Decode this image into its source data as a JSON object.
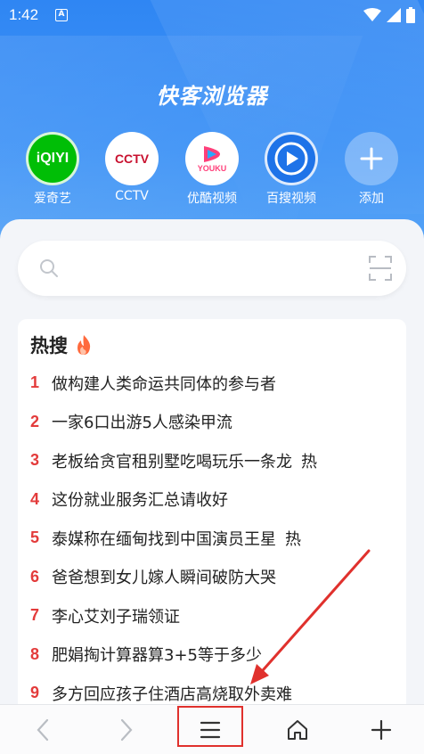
{
  "status_bar": {
    "time": "1:42",
    "notif_icon": "a-box-icon",
    "icons": [
      "wifi-icon",
      "signal-icon",
      "battery-icon"
    ]
  },
  "app": {
    "title": "快客浏览器"
  },
  "shortcuts": [
    {
      "label": "爱奇艺",
      "logo_text": "iQIYI",
      "icon": "iqiyi-logo-icon",
      "color": "#00be06"
    },
    {
      "label": "CCTV",
      "logo_text": "CCTV",
      "icon": "cctv-logo-icon",
      "color": "#ffffff"
    },
    {
      "label": "优酷视频",
      "logo_text": "YOUKU",
      "icon": "youku-logo-icon",
      "color": "#ffffff"
    },
    {
      "label": "百搜视频",
      "logo_text": "",
      "icon": "play-icon",
      "color": "#1e73e8"
    },
    {
      "label": "添加",
      "logo_text": "+",
      "icon": "plus-icon",
      "color": "rgba(255,255,255,0.35)"
    }
  ],
  "search": {
    "placeholder": "",
    "left_icon": "search-icon",
    "right_icon": "scan-icon"
  },
  "hot": {
    "title": "热搜",
    "title_icon": "flame-icon",
    "items": [
      {
        "rank": "1",
        "text": "做构建人类命运共同体的参与者",
        "tag": ""
      },
      {
        "rank": "2",
        "text": "一家6口出游5人感染甲流",
        "tag": ""
      },
      {
        "rank": "3",
        "text": "老板给贪官租别墅吃喝玩乐一条龙",
        "tag": "热"
      },
      {
        "rank": "4",
        "text": "这份就业服务汇总请收好",
        "tag": ""
      },
      {
        "rank": "5",
        "text": "泰媒称在缅甸找到中国演员王星",
        "tag": "热"
      },
      {
        "rank": "6",
        "text": "爸爸想到女儿嫁人瞬间破防大哭",
        "tag": ""
      },
      {
        "rank": "7",
        "text": "李心艾刘子瑞领证",
        "tag": ""
      },
      {
        "rank": "8",
        "text": "肥娟掏计算器算3+5等于多少",
        "tag": ""
      },
      {
        "rank": "9",
        "text": "多方回应孩子住酒店高烧取外卖难",
        "tag": ""
      }
    ]
  },
  "bottom_nav": {
    "items": [
      "back-arrow-icon",
      "forward-arrow-icon",
      "menu-icon",
      "home-icon",
      "plus-icon"
    ],
    "highlight_color": "#e0312d"
  },
  "colors": {
    "accent": "#2f86f3",
    "rank": "#e33b3b"
  }
}
